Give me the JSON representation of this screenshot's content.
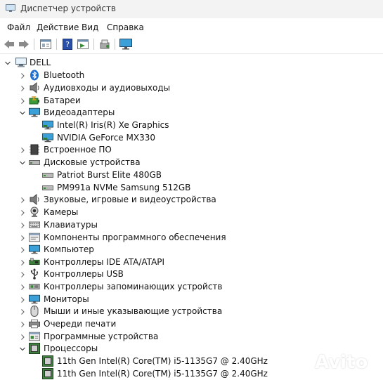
{
  "window": {
    "title": "Диспетчер устройств"
  },
  "menu": [
    "Файл",
    "Действие",
    "Вид",
    "Справка"
  ],
  "toolbar": {
    "buttons": [
      "back-arrow-icon",
      "forward-arrow-icon",
      "properties-icon",
      "help-icon",
      "view-icon",
      "scan-hardware-icon",
      "monitor-icon"
    ]
  },
  "tree": {
    "root": "DELL",
    "categories": [
      {
        "label": "Bluetooth",
        "icon": "bluetooth-icon",
        "expanded": false
      },
      {
        "label": "Аудиовходы и аудиовыходы",
        "icon": "speaker-icon",
        "expanded": false
      },
      {
        "label": "Батареи",
        "icon": "battery-icon",
        "expanded": false
      },
      {
        "label": "Видеоадаптеры",
        "icon": "display-adapter-icon",
        "expanded": true,
        "children": [
          "Intel(R) Iris(R) Xe Graphics",
          "NVIDIA GeForce MX330"
        ]
      },
      {
        "label": "Встроенное ПО",
        "icon": "firmware-icon",
        "expanded": false
      },
      {
        "label": "Дисковые устройства",
        "icon": "disk-icon",
        "expanded": true,
        "children": [
          "Patriot Burst Elite 480GB",
          "PM991a NVMe Samsung 512GB"
        ]
      },
      {
        "label": "Звуковые, игровые и видеоустройства",
        "icon": "sound-icon",
        "expanded": false
      },
      {
        "label": "Камеры",
        "icon": "camera-icon",
        "expanded": false
      },
      {
        "label": "Клавиатуры",
        "icon": "keyboard-icon",
        "expanded": false
      },
      {
        "label": "Компоненты программного обеспечения",
        "icon": "software-component-icon",
        "expanded": false
      },
      {
        "label": "Компьютер",
        "icon": "computer-icon",
        "expanded": false
      },
      {
        "label": "Контроллеры IDE ATA/ATAPI",
        "icon": "ide-controller-icon",
        "expanded": false
      },
      {
        "label": "Контроллеры USB",
        "icon": "usb-icon",
        "expanded": false
      },
      {
        "label": "Контроллеры запоминающих устройств",
        "icon": "storage-controller-icon",
        "expanded": false
      },
      {
        "label": "Мониторы",
        "icon": "monitor-icon",
        "expanded": false
      },
      {
        "label": "Мыши и иные указывающие устройства",
        "icon": "mouse-icon",
        "expanded": false
      },
      {
        "label": "Очереди печати",
        "icon": "printer-icon",
        "expanded": false
      },
      {
        "label": "Программные устройства",
        "icon": "software-device-icon",
        "expanded": false
      },
      {
        "label": "Процессоры",
        "icon": "processor-icon",
        "expanded": true,
        "children": [
          "11th Gen Intel(R) Core(TM) i5-1135G7 @ 2.40GHz",
          "11th Gen Intel(R) Core(TM) i5-1135G7 @ 2.40GHz"
        ]
      }
    ]
  },
  "watermark": {
    "text": "Avito"
  }
}
